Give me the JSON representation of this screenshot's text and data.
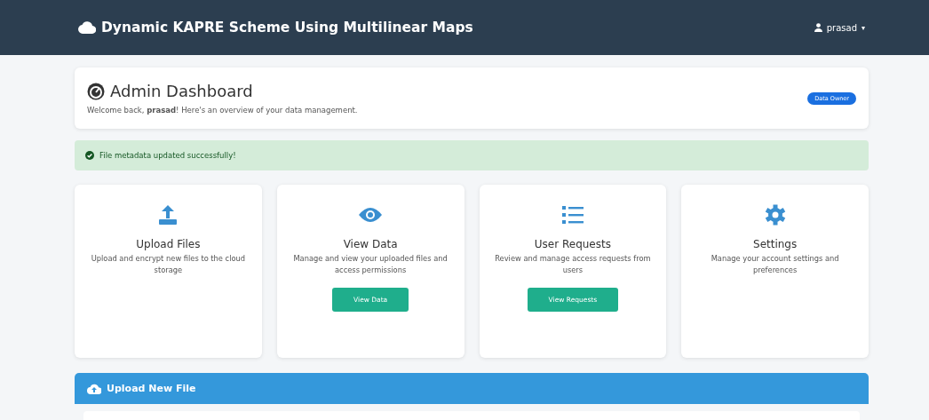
{
  "navbar": {
    "brand": "Dynamic KAPRE Scheme Using Multilinear Maps",
    "user": "prasad",
    "caret": "▾"
  },
  "header": {
    "title": "Admin Dashboard",
    "welcome": "Welcome back, **prasad**! Here's an overview of your data management.",
    "badge": "Data Owner"
  },
  "alert": {
    "message": "File metadata updated successfully!"
  },
  "cards": [
    {
      "kind": "upload",
      "title": "Upload Files",
      "description": "Upload and encrypt new files to the cloud storage"
    },
    {
      "kind": "view",
      "title": "View Data",
      "description": "Manage and view your uploaded files and access permissions",
      "button": "View Data"
    },
    {
      "kind": "requests",
      "title": "User Requests",
      "description": "Review and manage access requests from users",
      "button": "View Requests"
    },
    {
      "kind": "settings",
      "title": "Settings",
      "description": "Manage your account settings and preferences"
    }
  ],
  "upload_panel": {
    "title": "Upload New File"
  }
}
